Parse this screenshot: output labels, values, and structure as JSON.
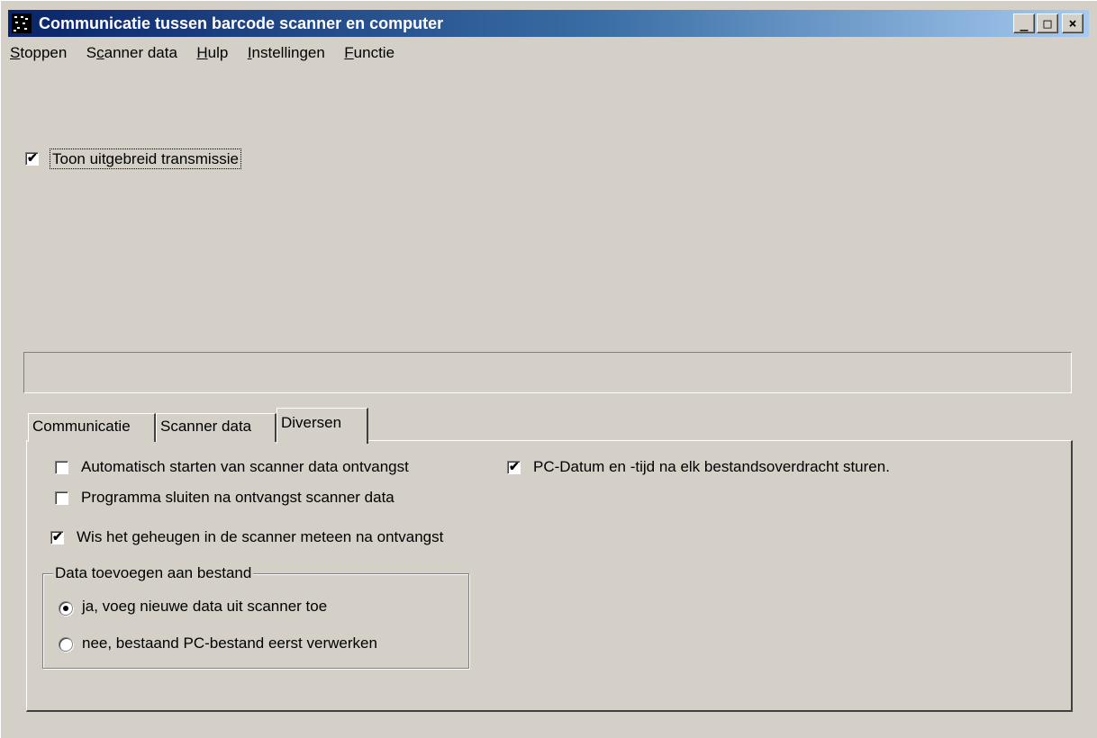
{
  "window": {
    "title": "Communicatie tussen barcode scanner en computer",
    "controls": {
      "minimize": "_",
      "maximize": "□",
      "close": "×"
    }
  },
  "menu": {
    "items": [
      {
        "label_rest": "toppen",
        "mnemonic": "S"
      },
      {
        "label_pre": "S",
        "mnemonic": "c",
        "label_rest": "anner data"
      },
      {
        "mnemonic": "H",
        "label_rest": "ulp"
      },
      {
        "mnemonic": "I",
        "label_rest": "nstellingen"
      },
      {
        "mnemonic": "F",
        "label_rest": "unctie"
      }
    ]
  },
  "options": {
    "show_transmission": {
      "label": "Toon uitgebreid transmissie",
      "checked": true
    }
  },
  "tabs": [
    {
      "label": "Communicatie",
      "active": false
    },
    {
      "label": "Scanner data",
      "active": false
    },
    {
      "label": "Diversen",
      "active": true
    }
  ],
  "diversen": {
    "auto_start": {
      "label": "Automatisch starten van scanner data ontvangst",
      "checked": false
    },
    "close_after": {
      "label": "Programma sluiten na ontvangst scanner data",
      "checked": false
    },
    "clear_memory": {
      "label": "Wis het geheugen in de scanner meteen na ontvangst",
      "checked": true
    },
    "send_datetime": {
      "label": "PC-Datum en -tijd na elk bestandsoverdracht sturen.",
      "checked": true
    },
    "append_group": {
      "legend": "Data toevoegen aan bestand",
      "options": [
        {
          "label": "ja, voeg nieuwe data uit scanner toe",
          "selected": true
        },
        {
          "label": "nee, bestaand PC-bestand eerst verwerken",
          "selected": false
        }
      ]
    }
  },
  "icons": {
    "app": "barcode-scanner-icon",
    "check": "✔"
  },
  "colors": {
    "title_start": "#0a246a",
    "title_end": "#a6caf0",
    "face": "#d4d0c8"
  }
}
